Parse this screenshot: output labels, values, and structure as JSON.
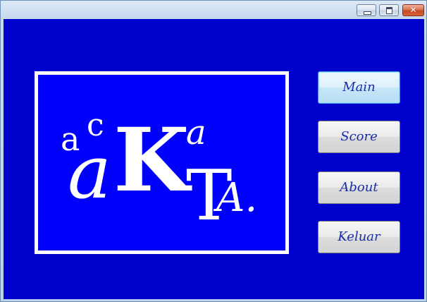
{
  "window": {
    "title": "",
    "controls": {
      "minimize_icon": "minimize-icon",
      "maximize_icon": "maximize-icon",
      "close_icon": "close-icon",
      "close_glyph": "✕"
    }
  },
  "logo": {
    "letters": {
      "small_a": "a",
      "small_c": "c",
      "big_a": "a",
      "big_k": "K",
      "small_a2": "a",
      "t": "T",
      "a_dot": "A."
    },
    "colors": {
      "background": "#0000fd",
      "text": "#ffffff"
    }
  },
  "menu": {
    "main_label": "Main",
    "score_label": "Score",
    "about_label": "About",
    "exit_label": "Keluar"
  },
  "colors": {
    "client_background": "#0000cd",
    "button_text": "#1a2ea8"
  }
}
